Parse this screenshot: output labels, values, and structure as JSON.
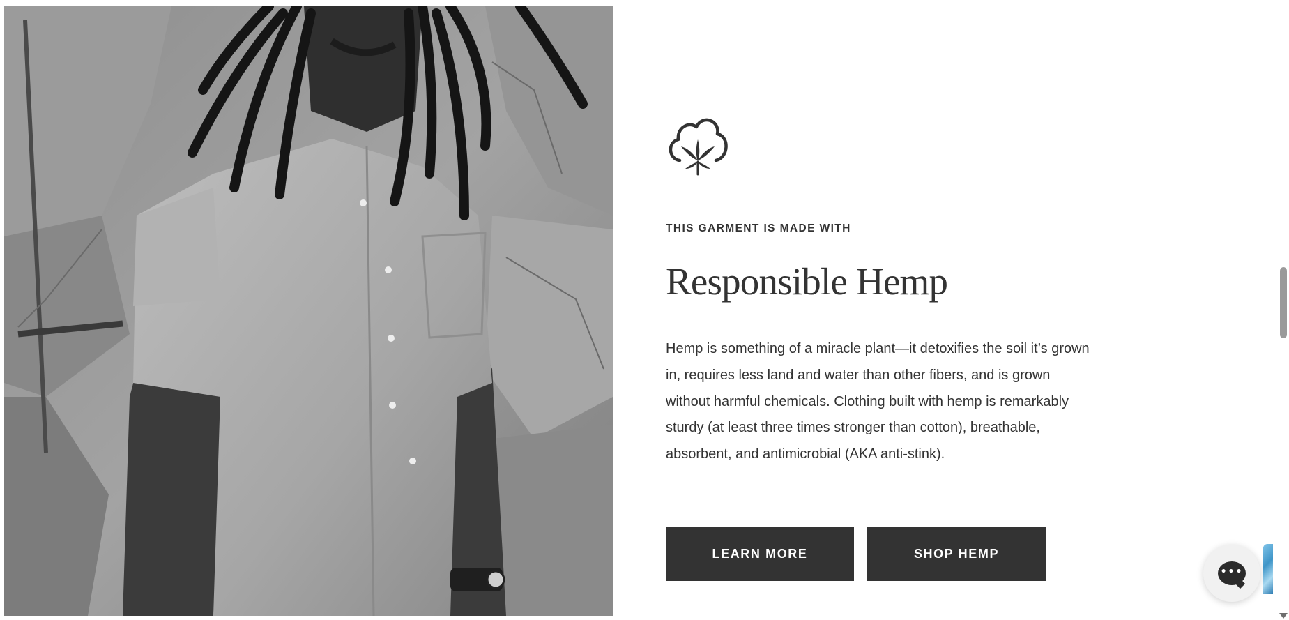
{
  "section": {
    "icon": "cotton-hemp-leaf-icon",
    "eyebrow": "THIS GARMENT IS MADE WITH",
    "headline": "Responsible Hemp",
    "body": "Hemp is something of a miracle plant—it detoxifies the soil it’s grown in, requires less land and water than other fibers, and is grown without harmful chemicals. Clothing built with hemp is remarkably sturdy (at least three times stronger than cotton), breathable, absorbent, and antimicrobial (AKA anti-stink)."
  },
  "buttons": {
    "learn_more": "LEARN MORE",
    "shop_hemp": "SHOP HEMP"
  },
  "photo": {
    "description_icon": "model-photo"
  },
  "chat": {
    "icon": "chat-icon",
    "dots": "•••"
  },
  "colors": {
    "text": "#333333",
    "button_bg": "#333333",
    "button_text": "#ffffff",
    "background": "#ffffff"
  }
}
